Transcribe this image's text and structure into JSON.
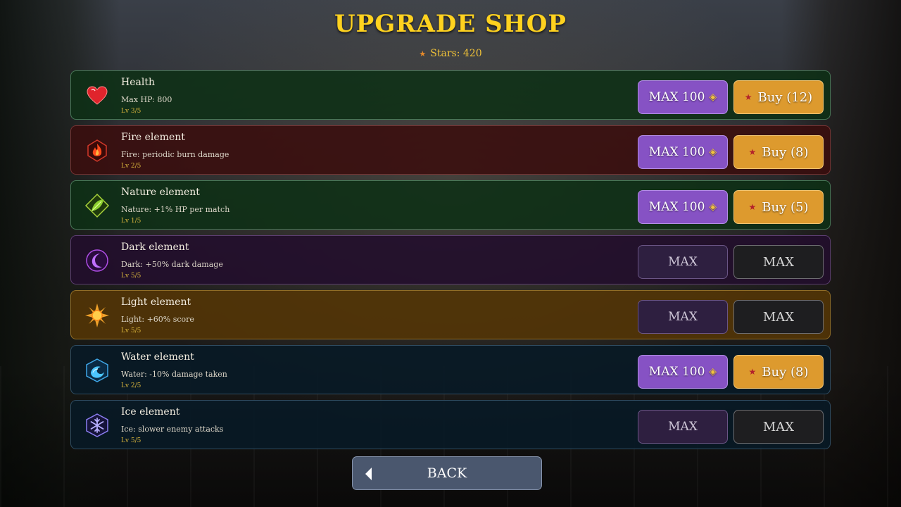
{
  "title": "UPGRADE SHOP",
  "stars_label": "Stars: 420",
  "upgrades": [
    {
      "name": "Health",
      "description": "Max HP: 800",
      "level": "Lv 3/5",
      "icon": "heart-icon",
      "theme": "green",
      "max_label": "MAX 100",
      "buy_label": "Buy (12)",
      "maxed": false
    },
    {
      "name": "Fire element",
      "description": "Fire: periodic burn damage",
      "level": "Lv 2/5",
      "icon": "fire-icon",
      "theme": "red",
      "max_label": "MAX 100",
      "buy_label": "Buy (8)",
      "maxed": false
    },
    {
      "name": "Nature element",
      "description": "Nature: +1% HP per match",
      "level": "Lv 1/5",
      "icon": "leaf-icon",
      "theme": "green",
      "max_label": "MAX 100",
      "buy_label": "Buy (5)",
      "maxed": false
    },
    {
      "name": "Dark element",
      "description": "Dark: +50% dark damage",
      "level": "Lv 5/5",
      "icon": "moon-icon",
      "theme": "purple",
      "max_label": "MAX",
      "buy_label": "MAX",
      "maxed": true
    },
    {
      "name": "Light element",
      "description": "Light: +60% score",
      "level": "Lv 5/5",
      "icon": "sun-icon",
      "theme": "amber",
      "max_label": "MAX",
      "buy_label": "MAX",
      "maxed": true
    },
    {
      "name": "Water element",
      "description": "Water: -10% damage taken",
      "level": "Lv 2/5",
      "icon": "water-icon",
      "theme": "navy",
      "max_label": "MAX 100",
      "buy_label": "Buy (8)",
      "maxed": false
    },
    {
      "name": "Ice element",
      "description": "Ice: slower enemy attacks",
      "level": "Lv 5/5",
      "icon": "snowflake-icon",
      "theme": "navy",
      "max_label": "MAX",
      "buy_label": "MAX",
      "maxed": true
    }
  ],
  "back_label": "BACK"
}
